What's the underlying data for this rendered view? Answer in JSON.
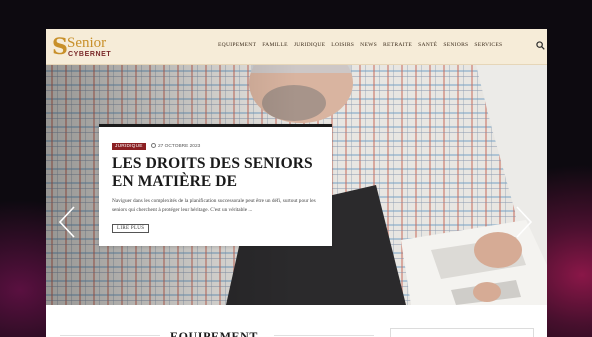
{
  "logo": {
    "mark": "S",
    "word": "Senior",
    "sub": "CYBERNET"
  },
  "nav": {
    "items": [
      "EQUIPEMENT",
      "FAMILLE",
      "JURIDIQUE",
      "LOISIRS",
      "NEWS",
      "RETRAITE",
      "SANTÉ",
      "SENIORS",
      "SERVICES"
    ]
  },
  "featured": {
    "category": "JURIDIQUE",
    "date": "27 OCTOBRE 2023",
    "title": "LES DROITS DES SENIORS EN MATIÈRE DE",
    "excerpt": "Naviguer dans les complexités de la planification successorale peut être un défi, surtout pour les seniors qui cherchent à protéger leur héritage. C'est un véritable ...",
    "read_more": "LIRE PLUS"
  },
  "section": {
    "title": "EQUIPEMENT"
  },
  "colors": {
    "accent": "#c8902a",
    "category": "#8b2023",
    "header_bg": "#f6ecd8"
  },
  "icons": {
    "search": "search-icon",
    "prev": "chevron-left-icon",
    "next": "chevron-right-icon",
    "clock": "clock-icon"
  }
}
